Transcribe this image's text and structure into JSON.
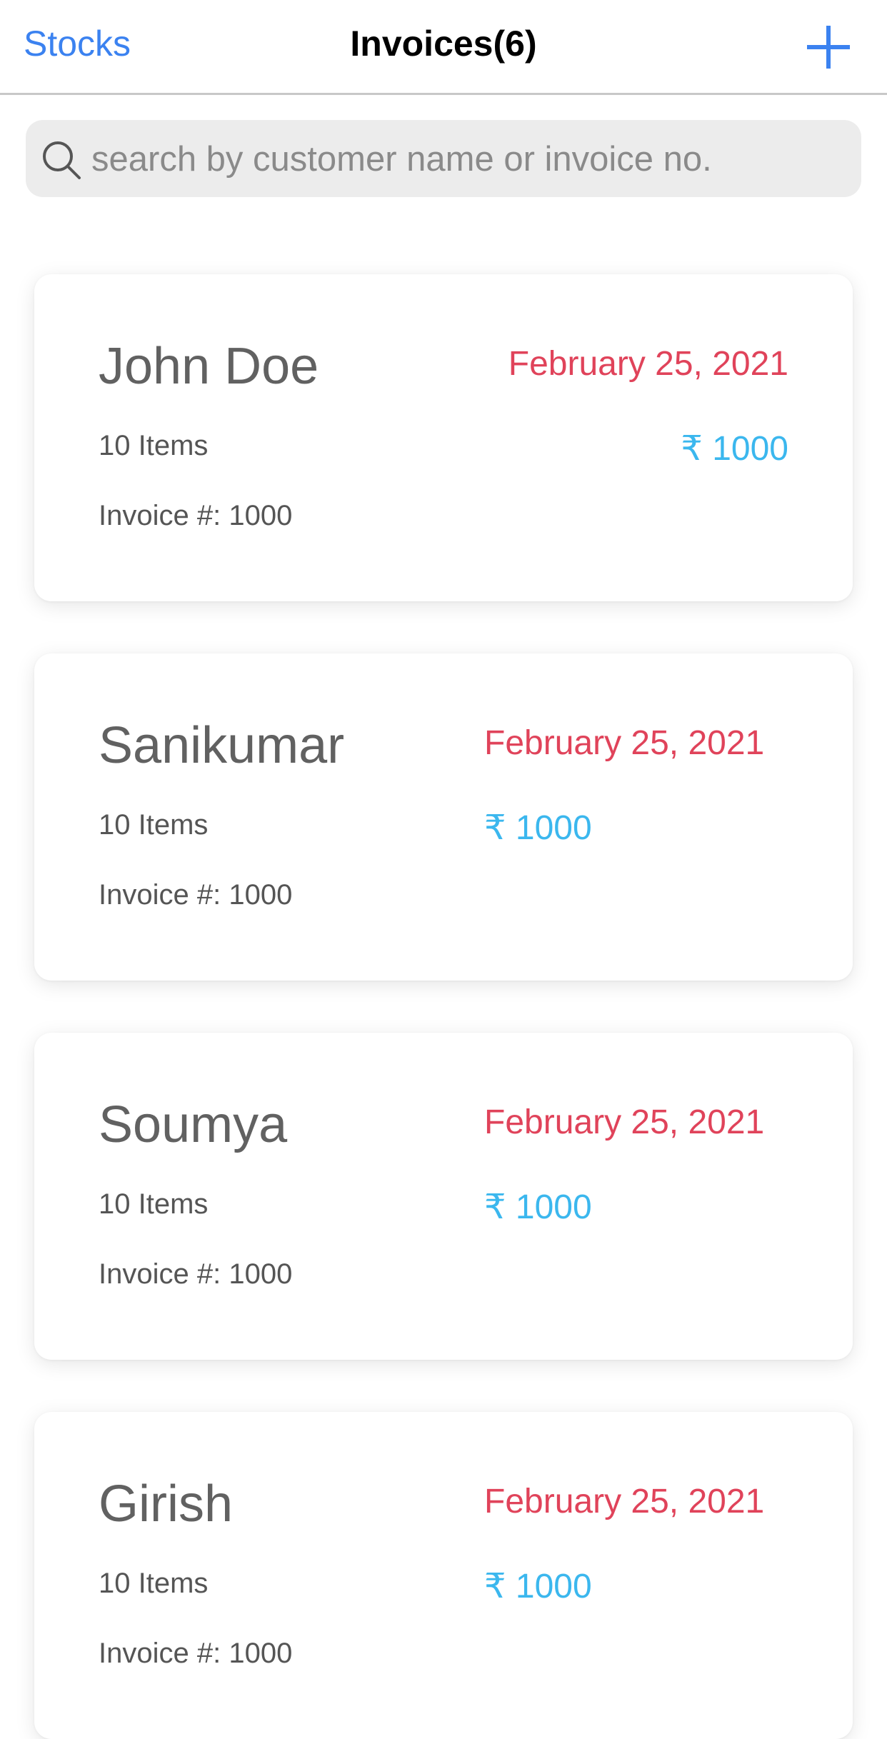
{
  "header": {
    "back_label": "Stocks",
    "title": "Invoices(6)",
    "add_icon": "plus-icon"
  },
  "search": {
    "icon": "search-icon",
    "placeholder": "search by customer name or invoice no.",
    "value": ""
  },
  "colors": {
    "accent": "#3b82f0",
    "date": "#e0435a",
    "amount": "#3bb7ee",
    "text": "#616161"
  },
  "invoices": [
    {
      "customer": "John Doe",
      "date": "February 25, 2021",
      "items": "10 Items",
      "amount": "₹ 1000",
      "invoice_no": "Invoice #: 1000"
    },
    {
      "customer": "Sanikumar",
      "date": "February 25, 2021",
      "items": "10 Items",
      "amount": "₹ 1000",
      "invoice_no": "Invoice #: 1000"
    },
    {
      "customer": "Soumya",
      "date": "February 25, 2021",
      "items": "10 Items",
      "amount": "₹ 1000",
      "invoice_no": "Invoice #: 1000"
    },
    {
      "customer": "Girish",
      "date": "February 25, 2021",
      "items": "10 Items",
      "amount": "₹ 1000",
      "invoice_no": "Invoice #: 1000"
    }
  ]
}
